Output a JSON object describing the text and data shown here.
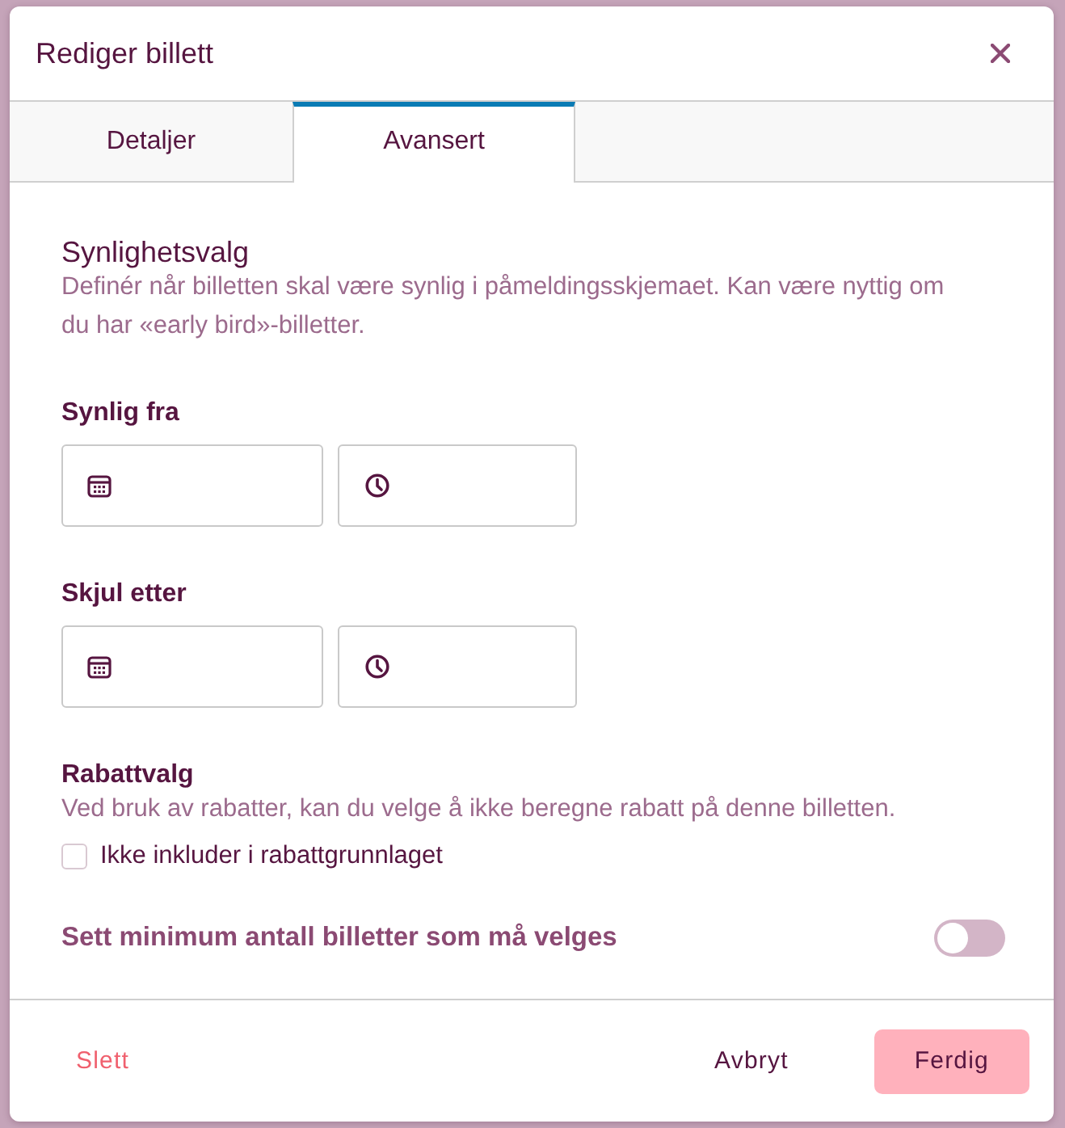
{
  "dialog": {
    "title": "Rediger billett"
  },
  "tabs": [
    {
      "label": "Detaljer",
      "selected": false
    },
    {
      "label": "Avansert",
      "selected": true
    }
  ],
  "visibility": {
    "heading": "Synlighetsvalg",
    "description": "Definér når billetten skal være synlig i påmeldingsskjemaet. Kan være nyttig om du har «early bird»-billetter.",
    "ranges": [
      {
        "label": "Synlig fra",
        "fields": [
          {
            "kind": "date"
          },
          {
            "kind": "time"
          }
        ]
      },
      {
        "label": "Skjul etter",
        "fields": [
          {
            "kind": "date"
          },
          {
            "kind": "time"
          }
        ]
      }
    ]
  },
  "discount": {
    "heading": "Rabattvalg",
    "description": "Ved bruk av rabatter, kan du velge å ikke beregne rabatt på denne billetten.",
    "checkbox": {
      "label": "Ikke inkluder i rabattgrunnlaget",
      "checked": false
    }
  },
  "minimum": {
    "label": "Sett minimum antall billetter som må velges",
    "on": false
  },
  "footer": {
    "buttons": [
      {
        "label": "Slett",
        "kind": "danger"
      },
      {
        "label": "Avbryt",
        "kind": "secondary"
      },
      {
        "label": "Ferdig",
        "kind": "primary"
      }
    ]
  }
}
